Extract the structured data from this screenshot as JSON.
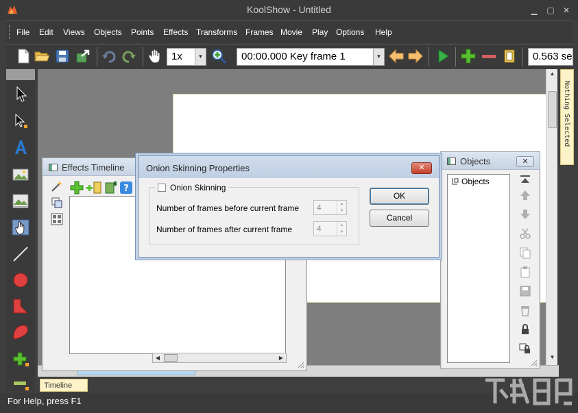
{
  "window": {
    "title": "KoolShow - Untitled"
  },
  "menu": [
    "File",
    "Edit",
    "Views",
    "Objects",
    "Points",
    "Effects",
    "Transforms",
    "Frames",
    "Movie",
    "Play",
    "Options",
    "Help"
  ],
  "toolbar": {
    "zoom_value": "1x",
    "time_value": "00:00.000  Key frame 1",
    "seconds_value": "0.563 se"
  },
  "side_tab": {
    "label": "Nothing Selected"
  },
  "effects_panel": {
    "title": "Effects Timeline"
  },
  "objects_panel": {
    "title": "Objects",
    "close_label": "✕",
    "tree_root": "Objects"
  },
  "dialog": {
    "title": "Onion Skinning Properties",
    "close_label": "✕",
    "checkbox_label": "Onion Skinning",
    "before_label": "Number of frames before current frame",
    "before_value": "4",
    "after_label": "Number of frames after current frame",
    "after_value": "4",
    "ok_label": "OK",
    "cancel_label": "Cancel"
  },
  "timeline_tab": {
    "label": "Timeline"
  },
  "status": {
    "text": "For Help, press F1"
  },
  "colors": {
    "chrome": "#3a3a3a",
    "canvas": "#7e7e7e",
    "stage": "#ffffff",
    "accent_green": "#2e9e2e",
    "accent_orange": "#f0a030"
  },
  "icons": [
    "app-logo-icon",
    "new-file-icon",
    "open-folder-icon",
    "save-icon",
    "export-icon",
    "undo-icon",
    "redo-icon",
    "hand-icon",
    "zoom-in-icon",
    "arrow-left-icon",
    "arrow-right-icon",
    "play-icon",
    "add-icon",
    "remove-icon",
    "frame-icon"
  ]
}
